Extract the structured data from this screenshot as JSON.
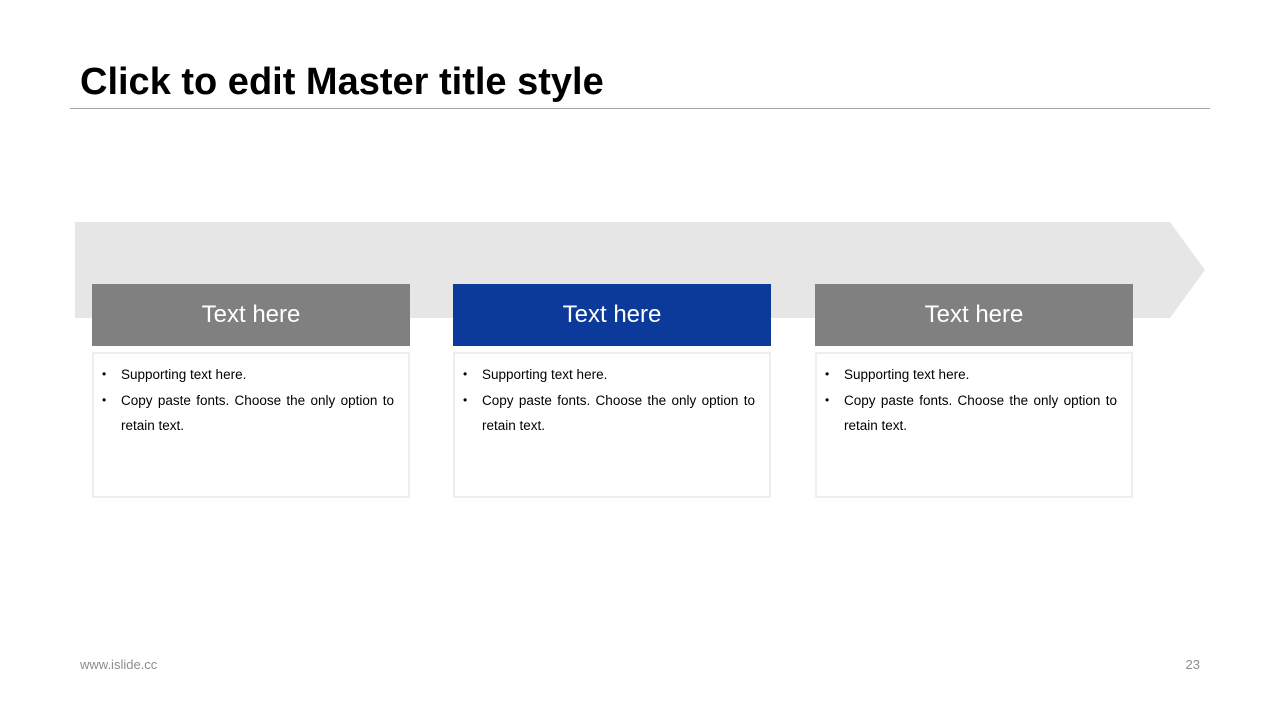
{
  "slide": {
    "title": "Click to edit Master title style",
    "footer_url": "www.islide.cc",
    "page_number": "23"
  },
  "colors": {
    "arrow_band": "#e6e6e6",
    "header_gray": "#808080",
    "header_blue": "#0b3a9a",
    "card_border": "#eeeeee",
    "title_rule": "#a6a6a6"
  },
  "cards": [
    {
      "header": "Text here",
      "header_color": "#808080",
      "bullets": [
        "Supporting  text here.",
        "Copy paste fonts. Choose the only option to retain text."
      ]
    },
    {
      "header": "Text here",
      "header_color": "#0b3a9a",
      "bullets": [
        "Supporting  text here.",
        "Copy paste fonts. Choose the only option to retain text."
      ]
    },
    {
      "header": "Text here",
      "header_color": "#808080",
      "bullets": [
        "Supporting  text here.",
        "Copy paste fonts. Choose the only option to retain text."
      ]
    }
  ]
}
